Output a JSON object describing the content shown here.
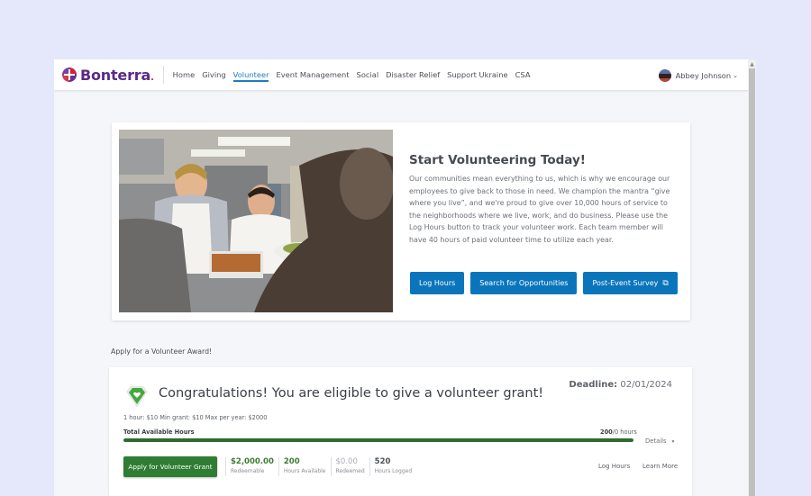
{
  "app": {
    "brand": "Bonterra",
    "brand_dot": "."
  },
  "nav": {
    "items": [
      {
        "label": "Home",
        "active": false
      },
      {
        "label": "Giving",
        "active": false
      },
      {
        "label": "Volunteer",
        "active": true
      },
      {
        "label": "Event Management",
        "active": false
      },
      {
        "label": "Social",
        "active": false
      },
      {
        "label": "Disaster Relief",
        "active": false
      },
      {
        "label": "Support Ukraine",
        "active": false
      },
      {
        "label": "CSA",
        "active": false
      }
    ],
    "user": {
      "name": "Abbey Johnson",
      "chevron": "⌄"
    }
  },
  "hero": {
    "image_alt": "Volunteers serving food in a kitchen",
    "title": "Start Volunteering Today!",
    "body": "Our communities mean everything to us, which is why we encourage our employees to give back to those in need. We champion the mantra “give where you live”, and we're proud to give over 10,000 hours of service to the neighborhoods where we live, work, and do business. Please use the Log Hours button to track your volunteer work. Each team member will have 40 hours of paid volunteer time to utilize each year.",
    "buttons": {
      "log_hours": "Log Hours",
      "search": "Search for Opportunities",
      "survey": "Post-Event Survey",
      "survey_icon": "⧉"
    }
  },
  "award_section": {
    "label": "Apply for a Volunteer Award!"
  },
  "grant": {
    "title": "Congratulations! You are eligible to give a volunteer grant!",
    "deadline_label": "Deadline:",
    "deadline_value": "02/01/2024",
    "rules": "1 hour: $10 Min grant: $10 Max per year: $2000",
    "total_label": "Total Available Hours",
    "total_available": "200",
    "total_suffix": "/0 hours",
    "progress_fraction": 1.0,
    "details_label": "Details",
    "details_chevron": "▾",
    "apply_button": "Apply for Volunteer Grant",
    "stats": [
      {
        "value": "$2,000.00",
        "label": "Redeemable"
      },
      {
        "value": "200",
        "label": "Hours Available"
      },
      {
        "value": "$0.00",
        "label": "Redeemed"
      },
      {
        "value": "520",
        "label": "Hours Logged"
      }
    ],
    "links": {
      "log_hours": "Log Hours",
      "learn_more": "Learn More"
    },
    "colors": {
      "accent_green": "#2e7d32",
      "accent_blue": "#0b75bb"
    }
  }
}
